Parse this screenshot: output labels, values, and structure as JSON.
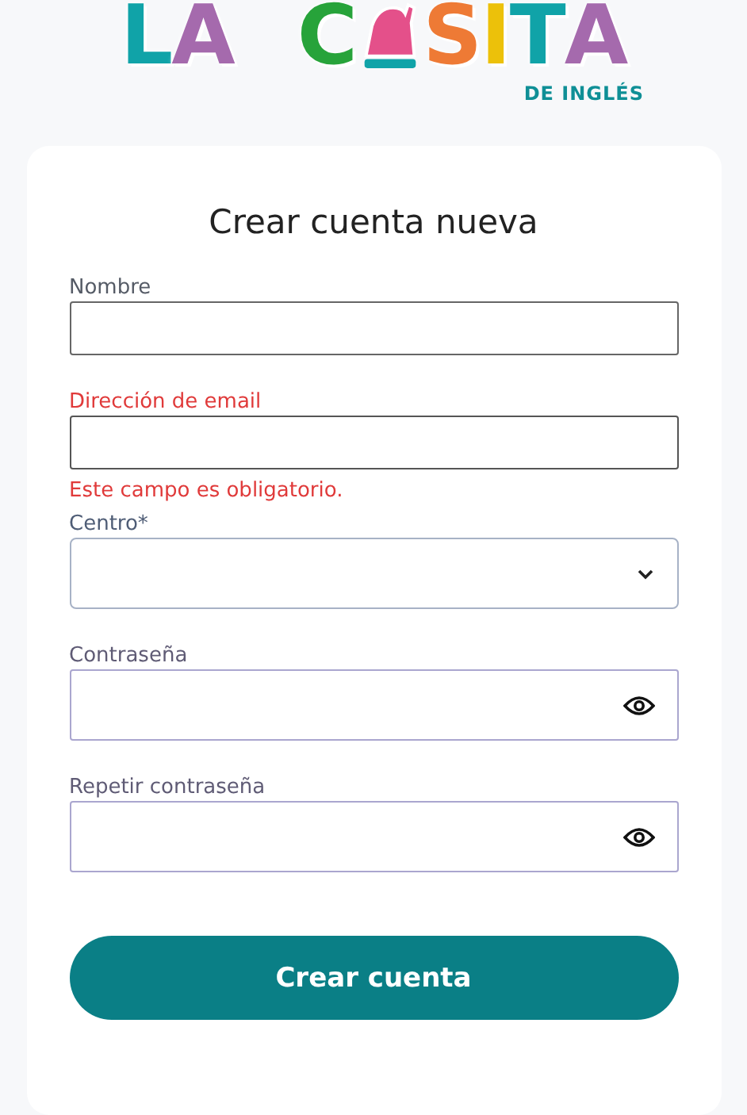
{
  "logo": {
    "letters": [
      {
        "text": "L",
        "color": "#10a3a8"
      },
      {
        "text": "A",
        "color": "#a56aad"
      },
      {
        "text": "C",
        "color": "#27a33a"
      },
      {
        "text": "S",
        "color": "#ee7a35"
      },
      {
        "text": "I",
        "color": "#ecc10a"
      },
      {
        "text": "T",
        "color": "#10a3a8"
      },
      {
        "text": "A",
        "color": "#a56aad"
      }
    ],
    "subtitle": "DE INGLÉS"
  },
  "title": "Crear cuenta nueva",
  "fields": [
    {
      "kind": "text",
      "label": "Nombre",
      "error": false
    },
    {
      "kind": "text",
      "label": "Dirección de email",
      "error": true,
      "error_message": "Este campo es obligatorio."
    },
    {
      "kind": "select",
      "label": "Centro*",
      "error": false
    },
    {
      "kind": "password",
      "label": "Contraseña",
      "error": false
    },
    {
      "kind": "password",
      "label": "Repetir contraseña",
      "error": false
    }
  ],
  "submit": "Crear cuenta"
}
